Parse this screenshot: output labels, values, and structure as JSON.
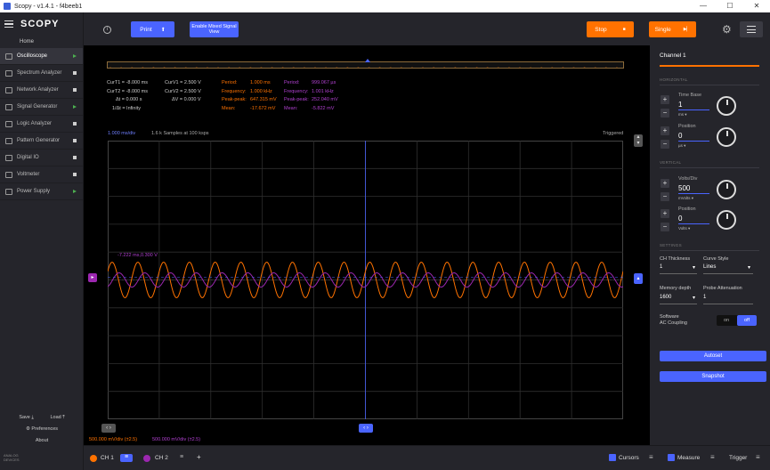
{
  "window": {
    "title": "Scopy - v1.4.1 - f4beeb1",
    "controls": [
      "—",
      "☐",
      "✕"
    ]
  },
  "left_menu": {
    "logo": "SCOPY",
    "home": "Home",
    "tools": [
      {
        "label": "Oscilloscope",
        "status": "running",
        "active": true
      },
      {
        "label": "Spectrum Analyzer",
        "status": "stopped"
      },
      {
        "label": "Network Analyzer",
        "status": "stopped"
      },
      {
        "label": "Signal Generator",
        "status": "running"
      },
      {
        "label": "Logic Analyzer",
        "status": "stopped"
      },
      {
        "label": "Pattern Generator",
        "status": "stopped"
      },
      {
        "label": "Digital IO",
        "status": "stopped"
      },
      {
        "label": "Voltmeter",
        "status": "stopped"
      },
      {
        "label": "Power Supply",
        "status": "running"
      }
    ],
    "save_label": "Save",
    "load_label": "Load",
    "preferences_label": "Preferences",
    "about_label": "About",
    "brand": "ANALOG DEVICES"
  },
  "toolbar": {
    "print_label": "Print",
    "mixed_signal_label": "Enable Mixed Signal View",
    "stop_label": "Stop",
    "single_label": "Single"
  },
  "measurements": {
    "cursors_time": [
      "CurT1 = -8.000 ms",
      "CurT2 = -8.000 ms",
      "Δt = 0.000 s",
      "1/Δt = Infinity"
    ],
    "cursors_volt": [
      "CurV1 = 2.500 V",
      "CurV2 = 2.500 V",
      "ΔV = 0.000 V"
    ],
    "ch1": [
      "Period:",
      "Frequency:",
      "Peak-peak:",
      "Mean:"
    ],
    "ch1_values": [
      "1.000 ms",
      "1.000 kHz",
      "647.315 mV",
      "-17.672 mV"
    ],
    "ch2": [
      "Period:",
      "Frequency:",
      "Peak-peak:",
      "Mean:"
    ],
    "ch2_values": [
      "999.067 µs",
      "1.001 kHz",
      "252.040 mV",
      "-5.822 mV"
    ]
  },
  "plot": {
    "time_div": "1.000 ms/div",
    "samples": "1.6 k Samples at 100 ksps",
    "trigger_status": "Triggered",
    "cursor_readout": "-7.222 ms,0.300 V",
    "ch1_scale": "500.000 mV/div (±2.5)",
    "ch2_scale": "500.000 mV/div (±2.5)",
    "ch1_color": "#ff7200",
    "ch2_color": "#9c27b0",
    "accent_color": "#4a64ff"
  },
  "right_panel": {
    "title": "Channel 1",
    "horizontal_section": "HORIZONTAL",
    "time_base_label": "Time Base",
    "time_base_value": "1",
    "time_base_unit": "ms",
    "h_position_label": "Position",
    "h_position_value": "0",
    "h_position_unit": "µs",
    "vertical_section": "VERTICAL",
    "volts_div_label": "Volts/Div",
    "volts_div_value": "500",
    "volts_div_unit": "mVolts",
    "v_position_label": "Position",
    "v_position_value": "0",
    "v_position_unit": "Volts",
    "settings_section": "SETTINGS",
    "ch_thickness_label": "CH Thickness",
    "ch_thickness_value": "1",
    "curve_style_label": "Curve Style",
    "curve_style_value": "Lines",
    "memory_depth_label": "Memory depth",
    "memory_depth_value": "1600",
    "probe_att_label": "Probe Attenuation",
    "probe_att_value": "1",
    "sw_ac_label_1": "Software",
    "sw_ac_label_2": "AC Coupling",
    "toggle_on": "on",
    "toggle_off": "off",
    "autoset_label": "Autoset",
    "snapshot_label": "Snapshot"
  },
  "bottom_bar": {
    "ch1_label": "CH 1",
    "ch2_label": "CH 2",
    "add_label": "+",
    "cursors_label": "Cursors",
    "measure_label": "Measure",
    "trigger_label": "Trigger"
  }
}
